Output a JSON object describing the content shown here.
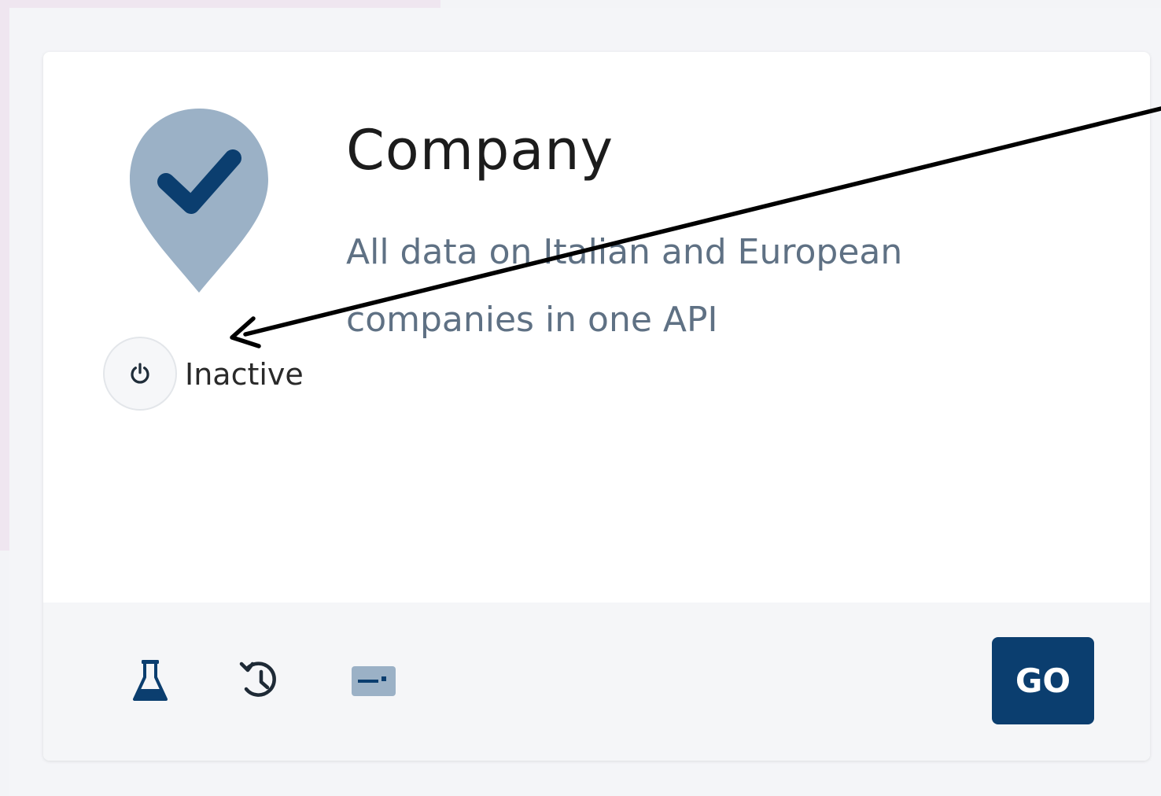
{
  "card": {
    "title": "Company",
    "description": "All data on Italian and European companies in one API",
    "status": "Inactive",
    "action_label": "GO",
    "icon": "location-check-icon"
  },
  "footer": {
    "icons": [
      "flask-icon",
      "history-icon",
      "card-icon"
    ]
  },
  "colors": {
    "brand": "#0b3e6f",
    "pin": "#9bb1c6",
    "description": "#5f7184"
  }
}
